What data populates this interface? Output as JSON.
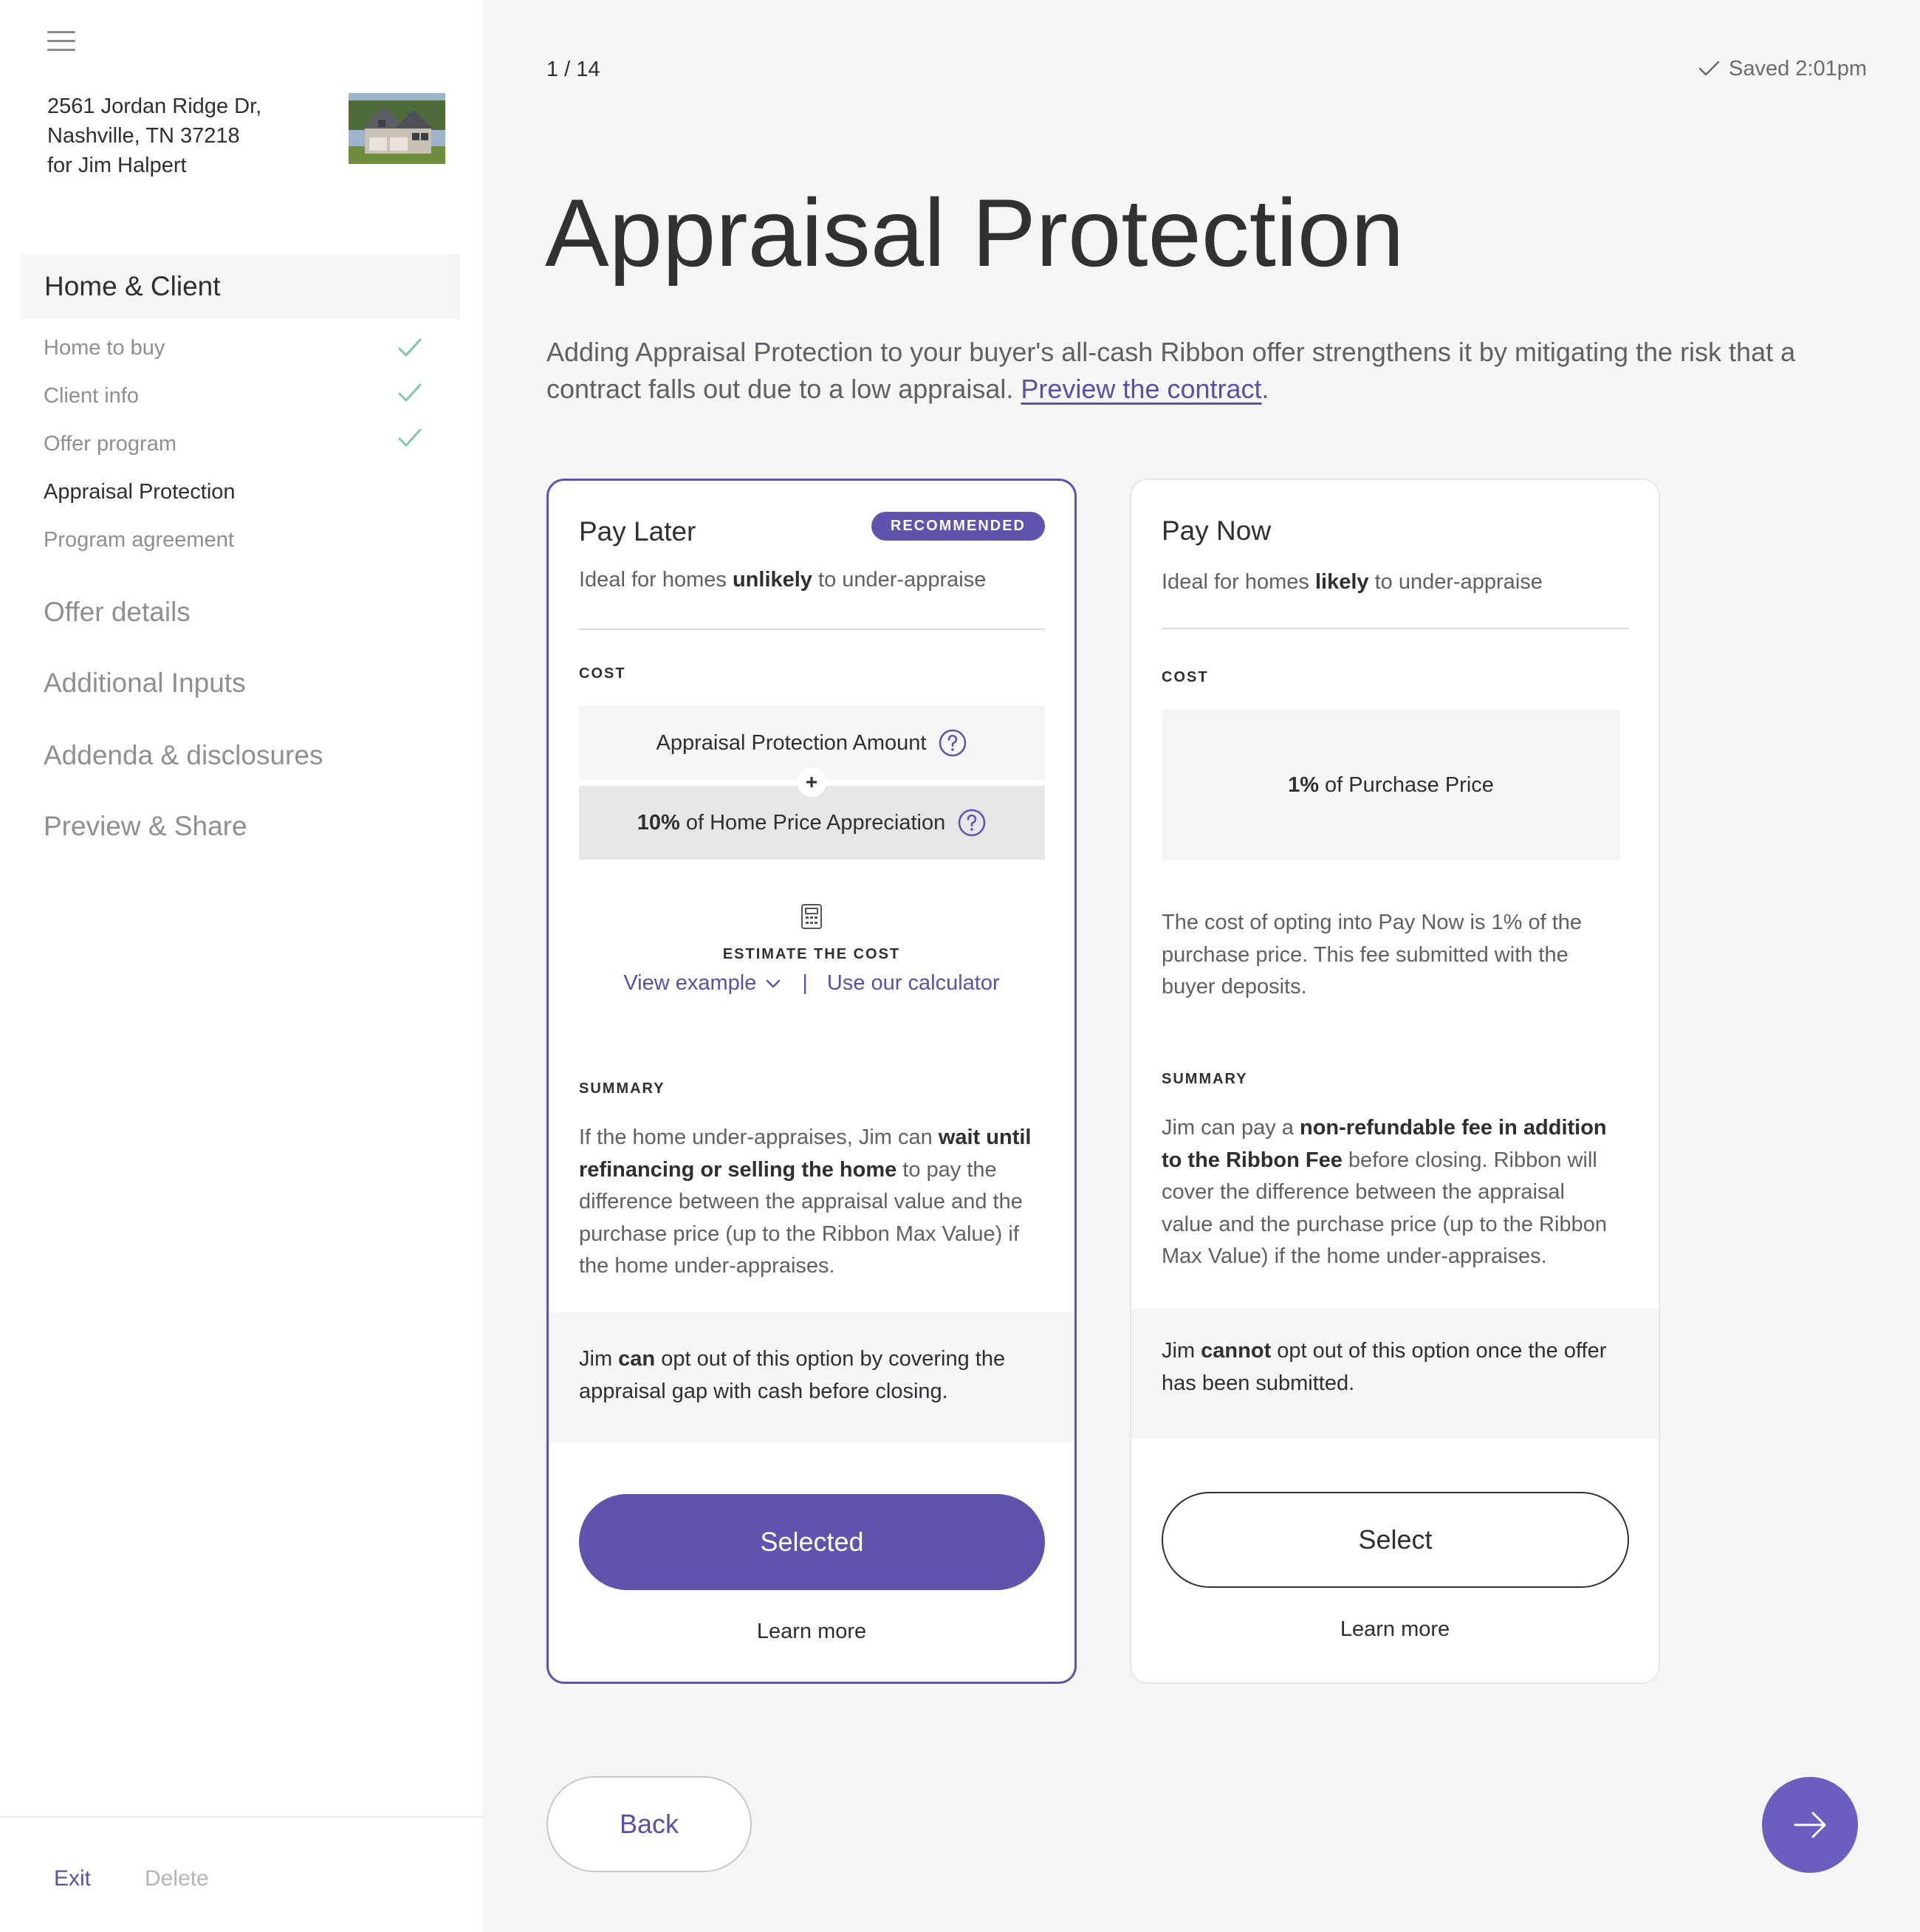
{
  "sidebar": {
    "address_line1": "2561 Jordan Ridge Dr,",
    "address_line2": "Nashville, TN 37218",
    "address_line3": "for Jim Halpert",
    "section_title": "Home & Client",
    "sub_items": [
      {
        "label": "Home to buy",
        "completed": true
      },
      {
        "label": "Client info",
        "completed": true
      },
      {
        "label": "Offer program",
        "completed": true
      },
      {
        "label": "Appraisal Protection",
        "completed": false,
        "active": true
      },
      {
        "label": "Program agreement",
        "completed": false
      }
    ],
    "main_nav": [
      "Offer details",
      "Additional Inputs",
      "Addenda & disclosures",
      "Preview & Share"
    ],
    "exit_label": "Exit",
    "delete_label": "Delete"
  },
  "header": {
    "step": "1 / 14",
    "saved": "Saved 2:01pm"
  },
  "main": {
    "title": "Appraisal Protection",
    "intro": "Adding Appraisal Protection to your buyer's all-cash Ribbon offer strengthens it by mitigating the risk that a contract falls out due to a low appraisal.",
    "intro_link": "Preview the contract",
    "intro_end": "."
  },
  "pay_later": {
    "title": "Pay Later",
    "badge": "RECOMMENDED",
    "sub_prefix": "Ideal for homes ",
    "sub_bold": "unlikely",
    "sub_suffix": " to under-appraise",
    "cost_label": "COST",
    "cost_line1": "Appraisal Protection Amount",
    "cost_plus": "+",
    "cost_line2_bold": "10%",
    "cost_line2": " of Home Price Appreciation",
    "estimate_label": "ESTIMATE THE COST",
    "view_example": "View example",
    "separator": "|",
    "calculator": "Use our calculator",
    "summary_label": "SUMMARY",
    "summary_a": "If the home under-appraises, Jim can ",
    "summary_bold": "wait until refinancing or selling the home",
    "summary_b": " to pay the difference between the appraisal value and the purchase price (up to the Ribbon Max Value) if the home under-appraises.",
    "note_a": "Jim ",
    "note_bold": "can",
    "note_b": " opt out of this option by covering the appraisal gap with cash before closing.",
    "button": "Selected",
    "learn_more": "Learn more"
  },
  "pay_now": {
    "title": "Pay Now",
    "sub_prefix": "Ideal for homes ",
    "sub_bold": "likely",
    "sub_suffix": " to under-appraise",
    "cost_label": "COST",
    "cost_bold": "1%",
    "cost_text": "of Purchase Price",
    "cost_desc": "The cost of opting into Pay Now is 1% of the purchase price. This fee submitted with the buyer deposits.",
    "summary_label": "SUMMARY",
    "summary_a": "Jim can pay a ",
    "summary_bold": "non-refundable fee in addition to the Ribbon Fee",
    "summary_b": " before closing. Ribbon will cover the difference between the appraisal value and the purchase price (up to the Ribbon Max Value) if the home under-appraises.",
    "note_a": "Jim ",
    "note_bold": "cannot",
    "note_b": " opt out of this option once the offer has been submitted.",
    "button": "Select",
    "learn_more": "Learn more"
  },
  "footer": {
    "back": "Back"
  },
  "colors": {
    "accent": "#5e54ad",
    "check": "#7fc9a0"
  }
}
